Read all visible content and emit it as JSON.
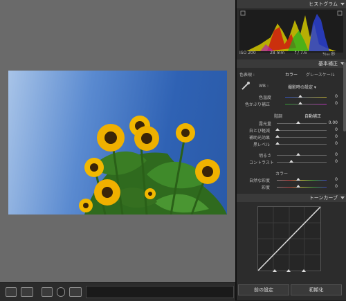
{
  "histogram": {
    "title": "ヒストグラム",
    "iso": "ISO 200",
    "focal": "28 mm",
    "aperture": "f / 7.6",
    "shutter": "¹⁄₂₅₀ 秒"
  },
  "basic": {
    "title": "基本補正",
    "treatment_label": "色表現 :",
    "color_option": "カラー",
    "gray_option": "グレースケール",
    "wb_label": "WB :",
    "wb_value": "撮影時の設定 ▾",
    "temp_label": "色温度",
    "tint_label": "色かぶり補正",
    "tone_label": "階調",
    "auto_label": "自動補正",
    "exposure_label": "露光量",
    "recovery_label": "白とび軽減",
    "fill_label": "補助光効果",
    "blacks_label": "黒レベル",
    "brightness_label": "明るさ",
    "contrast_label": "コントラスト",
    "presence_label": "カラー",
    "vibrance_label": "自然な彩度",
    "saturation_label": "彩度",
    "temp_value": "0",
    "tint_value": "0",
    "exposure_value": "0.00",
    "recovery_value": "0",
    "fill_value": "0",
    "blacks_value": "0",
    "brightness_value": "0",
    "contrast_value": "0",
    "vibrance_value": "0",
    "saturation_value": "0"
  },
  "tonecurve": {
    "title": "トーンカーブ"
  },
  "buttons": {
    "previous": "前の設定",
    "reset": "初期化"
  },
  "colors": {
    "panel_bg": "#2c2c2c",
    "viewer_bg": "#6a6a6a",
    "sky": "#2f62b4"
  }
}
